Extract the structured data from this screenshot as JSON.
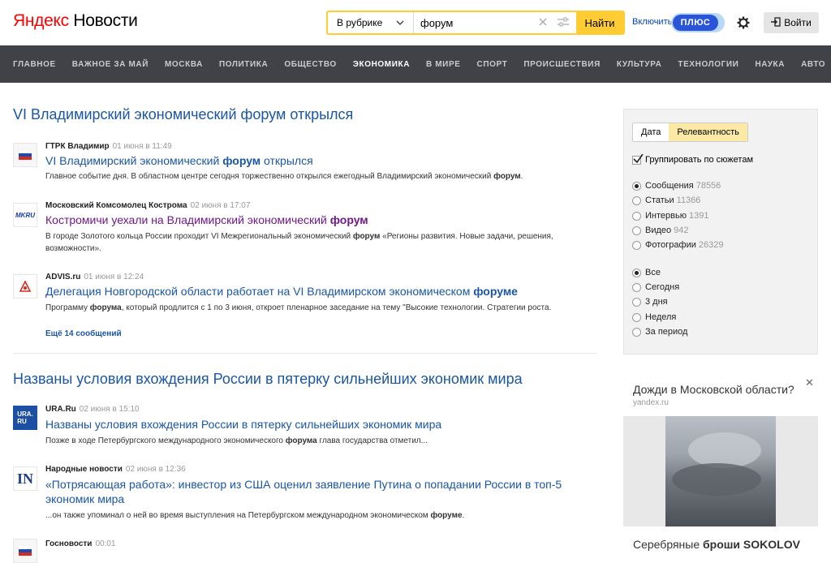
{
  "header": {
    "logo_ya": "Яндекс",
    "logo_news": "Новости",
    "search_scope": "В рубрике",
    "search_value": "форум",
    "search_button": "Найти",
    "plus_link": "Включить",
    "plus_badge": "ПЛЮС",
    "login": "Войти"
  },
  "nav": {
    "items": [
      "ГЛАВНОЕ",
      "ВАЖНОЕ ЗА МАЙ",
      "МОСКВА",
      "ПОЛИТИКА",
      "ОБЩЕСТВО",
      "ЭКОНОМИКА",
      "В МИРЕ",
      "СПОРТ",
      "ПРОИСШЕСТВИЯ",
      "КУЛЬТУРА",
      "ТЕХНОЛОГИИ",
      "НАУКА",
      "АВТО"
    ],
    "active": "ЭКОНОМИКА"
  },
  "stories": [
    {
      "title": "VI Владимирский экономический форум открылся",
      "items": [
        {
          "agency": "ГТРК Владимир",
          "time": "01 июня в 11:49",
          "headline_pre": "VI Владимирский экономический ",
          "headline_bold": "форум",
          "headline_post": " открылся",
          "snippet_pre": "Главное событие дня. В областном центре сегодня торжественно открылся ежегодный Владимирский экономический ",
          "snippet_bold": "форум",
          "snippet_post": "."
        },
        {
          "agency": "Московский Комсомолец Кострома",
          "time": "02 июня в 17:07",
          "logo_text": "MKRU",
          "headline_pre": "Костромичи уехали на Владимирский экономический ",
          "headline_bold": "форум",
          "headline_post": "",
          "snippet_pre": "В городе Золотого кольца России проходит VI Межрегиональный экономический ",
          "snippet_bold": "форум",
          "snippet_post": " «Регионы развития. Новые задачи, решения, возможности»."
        },
        {
          "agency": "ADVIS.ru",
          "time": "01 июня в 12:24",
          "headline_pre": "Делегация Новгородской области работает на VI Владимирском экономическом ",
          "headline_bold": "форуме",
          "headline_post": "",
          "snippet_pre": "Программу ",
          "snippet_bold": "форума",
          "snippet_post": ", который продлится с 1 по 3 июня, откроет пленарное заседание на тему \"Высокие технологии. Стратегии роста."
        }
      ],
      "more": "Ещё 14 сообщений"
    },
    {
      "title": "Названы условия вхождения России в пятерку сильнейших экономик мира",
      "items": [
        {
          "agency": "URA.Ru",
          "time": "02 июня в 15:10",
          "logo_text": "URA.\nRU",
          "headline": "Названы условия вхождения России в пятерку сильнейших экономик мира",
          "snippet_pre": "Позже в ходе Петербургского международного экономического ",
          "snippet_bold": "форума",
          "snippet_post": " глава государства отметил..."
        },
        {
          "agency": "Народные новости",
          "time": "02 июня в 12:36",
          "logo_text": "IN",
          "headline": "«Потрясающая работа»: инвестор из США оценил заявление Путина о попадании России в топ-5 экономик мира",
          "snippet_pre": "...он также упоминал о ней во время выступления на Петербургском международном экономическом ",
          "snippet_bold": "форуме",
          "snippet_post": "."
        },
        {
          "agency": "Госновости",
          "time": "00:01"
        }
      ]
    }
  ],
  "sidebar": {
    "sort_tabs": [
      "Дата",
      "Релевантность"
    ],
    "sort_active": "Релевантность",
    "group_label": "Группировать по сюжетам",
    "types": [
      {
        "label": "Сообщения",
        "count": "78556",
        "checked": true
      },
      {
        "label": "Статьи",
        "count": "11366",
        "checked": false
      },
      {
        "label": "Интервью",
        "count": "1391",
        "checked": false
      },
      {
        "label": "Видео",
        "count": "942",
        "checked": false
      },
      {
        "label": "Фотографии",
        "count": "26329",
        "checked": false
      }
    ],
    "periods": [
      {
        "label": "Все",
        "checked": true
      },
      {
        "label": "Сегодня",
        "checked": false
      },
      {
        "label": "3 дня",
        "checked": false
      },
      {
        "label": "Неделя",
        "checked": false
      },
      {
        "label": "За период",
        "checked": false
      }
    ]
  },
  "ads": {
    "ad1_title": "Дожди в Московской области?",
    "ad1_domain": "yandex.ru",
    "ad2_title_pre": "Серебряные ",
    "ad2_title_bold": "броши SOKOLOV"
  },
  "colors": {
    "accent": "#ffcc33",
    "link": "#1a56a4",
    "visited": "#70178a",
    "nav_bg": "#404247",
    "logo_red": "#ff0000"
  }
}
